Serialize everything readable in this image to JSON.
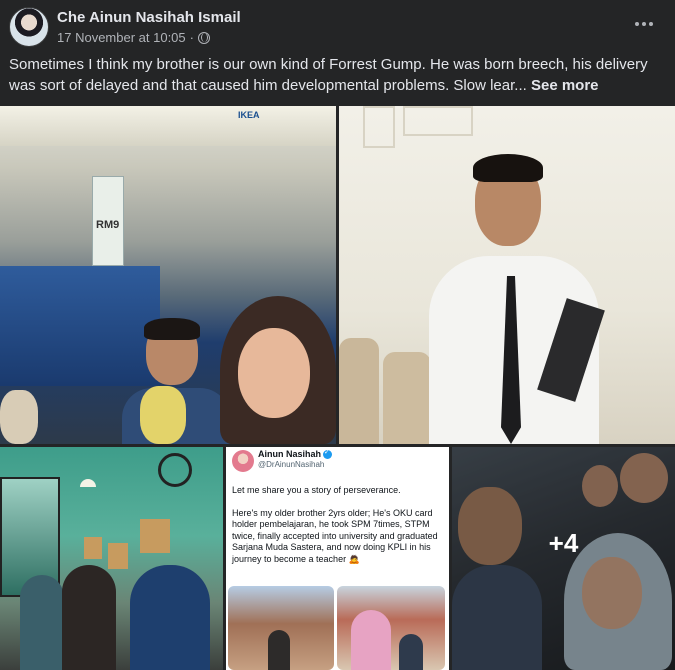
{
  "post": {
    "author": "Che Ainun Nasihah Ismail",
    "timestamp": "17 November at 10:05",
    "separator": "·",
    "text": "Sometimes I think my brother is our own kind of Forrest Gump. He was born breech, his delivery was sort of delayed and that caused him developmental problems. Slow lear...",
    "see_more": "See more"
  },
  "photos": {
    "p1_sign": "RM9",
    "p1_store_sign": "IKEA",
    "more_count": "+4"
  },
  "tweet": {
    "name": "Ainun Nasihah",
    "handle": "@DrAinunNasihah",
    "para1": "Let me share you a story of perseverance.",
    "para2": "Here's my older brother 2yrs older; He's OKU card holder pembelajaran, he took SPM 7times, STPM twice, finally accepted into university and graduated Sarjana Muda Sastera, and now doing KPLI in his journey to become a teacher 🙇"
  },
  "icons": {
    "privacy": "globe-icon",
    "menu": "more-options-icon",
    "verified": "verified-badge-icon"
  }
}
